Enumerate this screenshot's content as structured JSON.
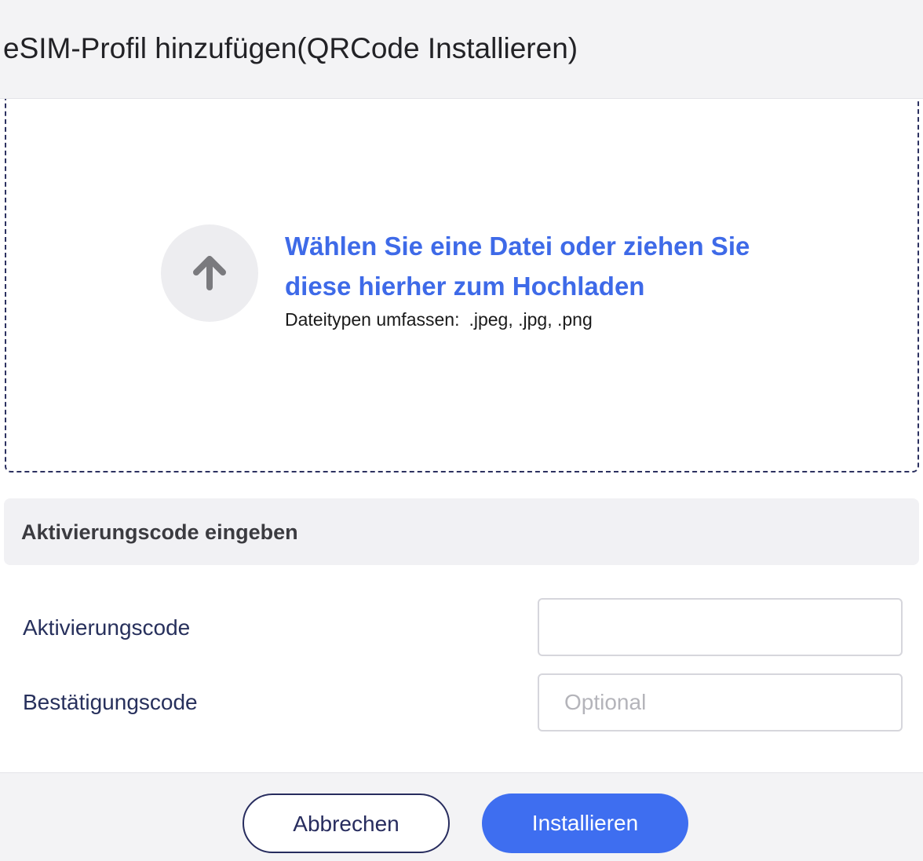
{
  "dialog": {
    "title": "eSIM-Profil hinzufügen(QRCode Installieren)"
  },
  "upload": {
    "icon": "arrow-up-icon",
    "prompt": "Wählen Sie eine Datei oder ziehen Sie diese hierher zum Hochladen",
    "types_label": "Dateitypen umfassen:",
    "types_values": ".jpeg, .jpg, .png"
  },
  "activation_section": {
    "title": "Aktivierungscode eingeben"
  },
  "fields": {
    "activation_code": {
      "label": "Aktivierungscode",
      "value": "",
      "placeholder": ""
    },
    "confirmation_code": {
      "label": "Bestätigungscode",
      "value": "",
      "placeholder": "Optional"
    }
  },
  "footer": {
    "cancel_label": "Abbrechen",
    "install_label": "Installieren"
  },
  "colors": {
    "accent": "#3e6ef0",
    "link_text": "#3e6ae8",
    "label_text": "#27305c",
    "dropzone_border": "#2c3160"
  }
}
